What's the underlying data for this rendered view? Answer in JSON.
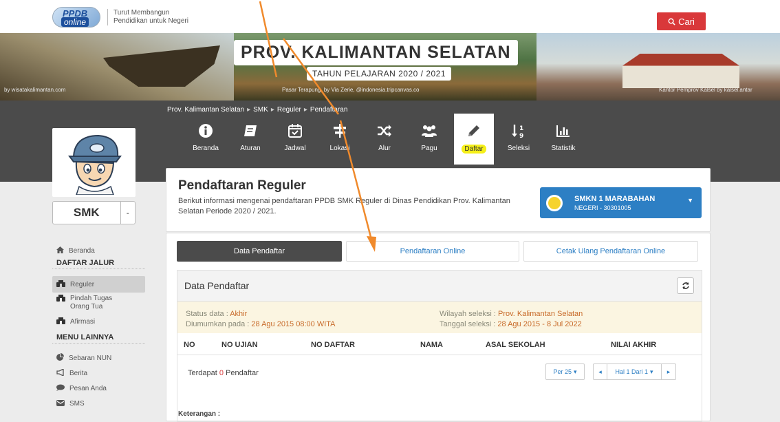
{
  "header": {
    "logo_ppdb": "PPDB",
    "logo_online": "online",
    "tagline_1": "Turut Membangun",
    "tagline_2": "Pendidikan untuk Negeri",
    "search_label": "Cari"
  },
  "banner": {
    "title": "PROV. KALIMANTAN SELATAN",
    "subtitle": "TAHUN PELAJARAN 2020 / 2021",
    "caption_left": "by wisatakalimantan.com",
    "caption_mid": "Pasar Terapung, by Via Zerie, @indonesia.tripcanvas.co",
    "caption_right": "Kantor Pemprov Kalsel by kalsel.antar"
  },
  "breadcrumb": [
    "Prov. Kalimantan Selatan",
    "SMK",
    "Reguler",
    "Pendaftaran"
  ],
  "nav": [
    {
      "label": "Beranda",
      "icon": "info-icon"
    },
    {
      "label": "Aturan",
      "icon": "book-icon"
    },
    {
      "label": "Jadwal",
      "icon": "calendar-icon"
    },
    {
      "label": "Lokasi",
      "icon": "signpost-icon"
    },
    {
      "label": "Alur",
      "icon": "shuffle-icon"
    },
    {
      "label": "Pagu",
      "icon": "users-icon"
    },
    {
      "label": "Daftar",
      "icon": "pencil-icon"
    },
    {
      "label": "Seleksi",
      "icon": "sort-numeric-icon"
    },
    {
      "label": "Statistik",
      "icon": "bar-chart-icon"
    }
  ],
  "sidebar": {
    "jenjang": "SMK",
    "home": "Beranda",
    "section_jalur": "DAFTAR JALUR",
    "jalur": [
      "Reguler",
      "Pindah Tugas Orang Tua",
      "Afirmasi"
    ],
    "section_lain": "MENU LAINNYA",
    "lain": [
      "Sebaran NUN",
      "Berita",
      "Pesan Anda",
      "SMS"
    ]
  },
  "page": {
    "title": "Pendaftaran Reguler",
    "description": "Berikut informasi mengenai pendaftaran PPDB SMK Reguler di Dinas Pendidikan Prov. Kalimantan Selatan Periode 2020 / 2021.",
    "school_name": "SMKN 1 MARABAHAN",
    "school_sub": "NEGERI - 30301005"
  },
  "tabs": [
    "Data Pendaftar",
    "Pendaftaran Online",
    "Cetak Ulang Pendaftaran Online"
  ],
  "panel": {
    "title": "Data Pendaftar",
    "status_label": "Status data : ",
    "status_value": "Akhir",
    "announced_label": "Diumumkan pada : ",
    "announced_value": "28 Agu 2015 08:00 WITA",
    "region_label": "Wilayah seleksi : ",
    "region_value": "Prov. Kalimantan Selatan",
    "date_label": "Tanggal seleksi : ",
    "date_value": "28 Agu 2015 - 8 Jul 2022",
    "columns": [
      "NO",
      "NO UJIAN",
      "NO DAFTAR",
      "NAMA",
      "ASAL SEKOLAH",
      "NILAI AKHIR"
    ],
    "count_prefix": "Terdapat ",
    "count": "0",
    "count_suffix": " Pendaftar",
    "per_page": "Per 25",
    "page_info": "Hal 1 Dari 1"
  },
  "footer": {
    "keterangan": "Keterangan :"
  },
  "colors": {
    "accent": "#2d7fc4",
    "danger": "#d9383a",
    "dark": "#4b4b4b",
    "highlight": "#f5ef18",
    "arrow": "#f08a2c"
  }
}
